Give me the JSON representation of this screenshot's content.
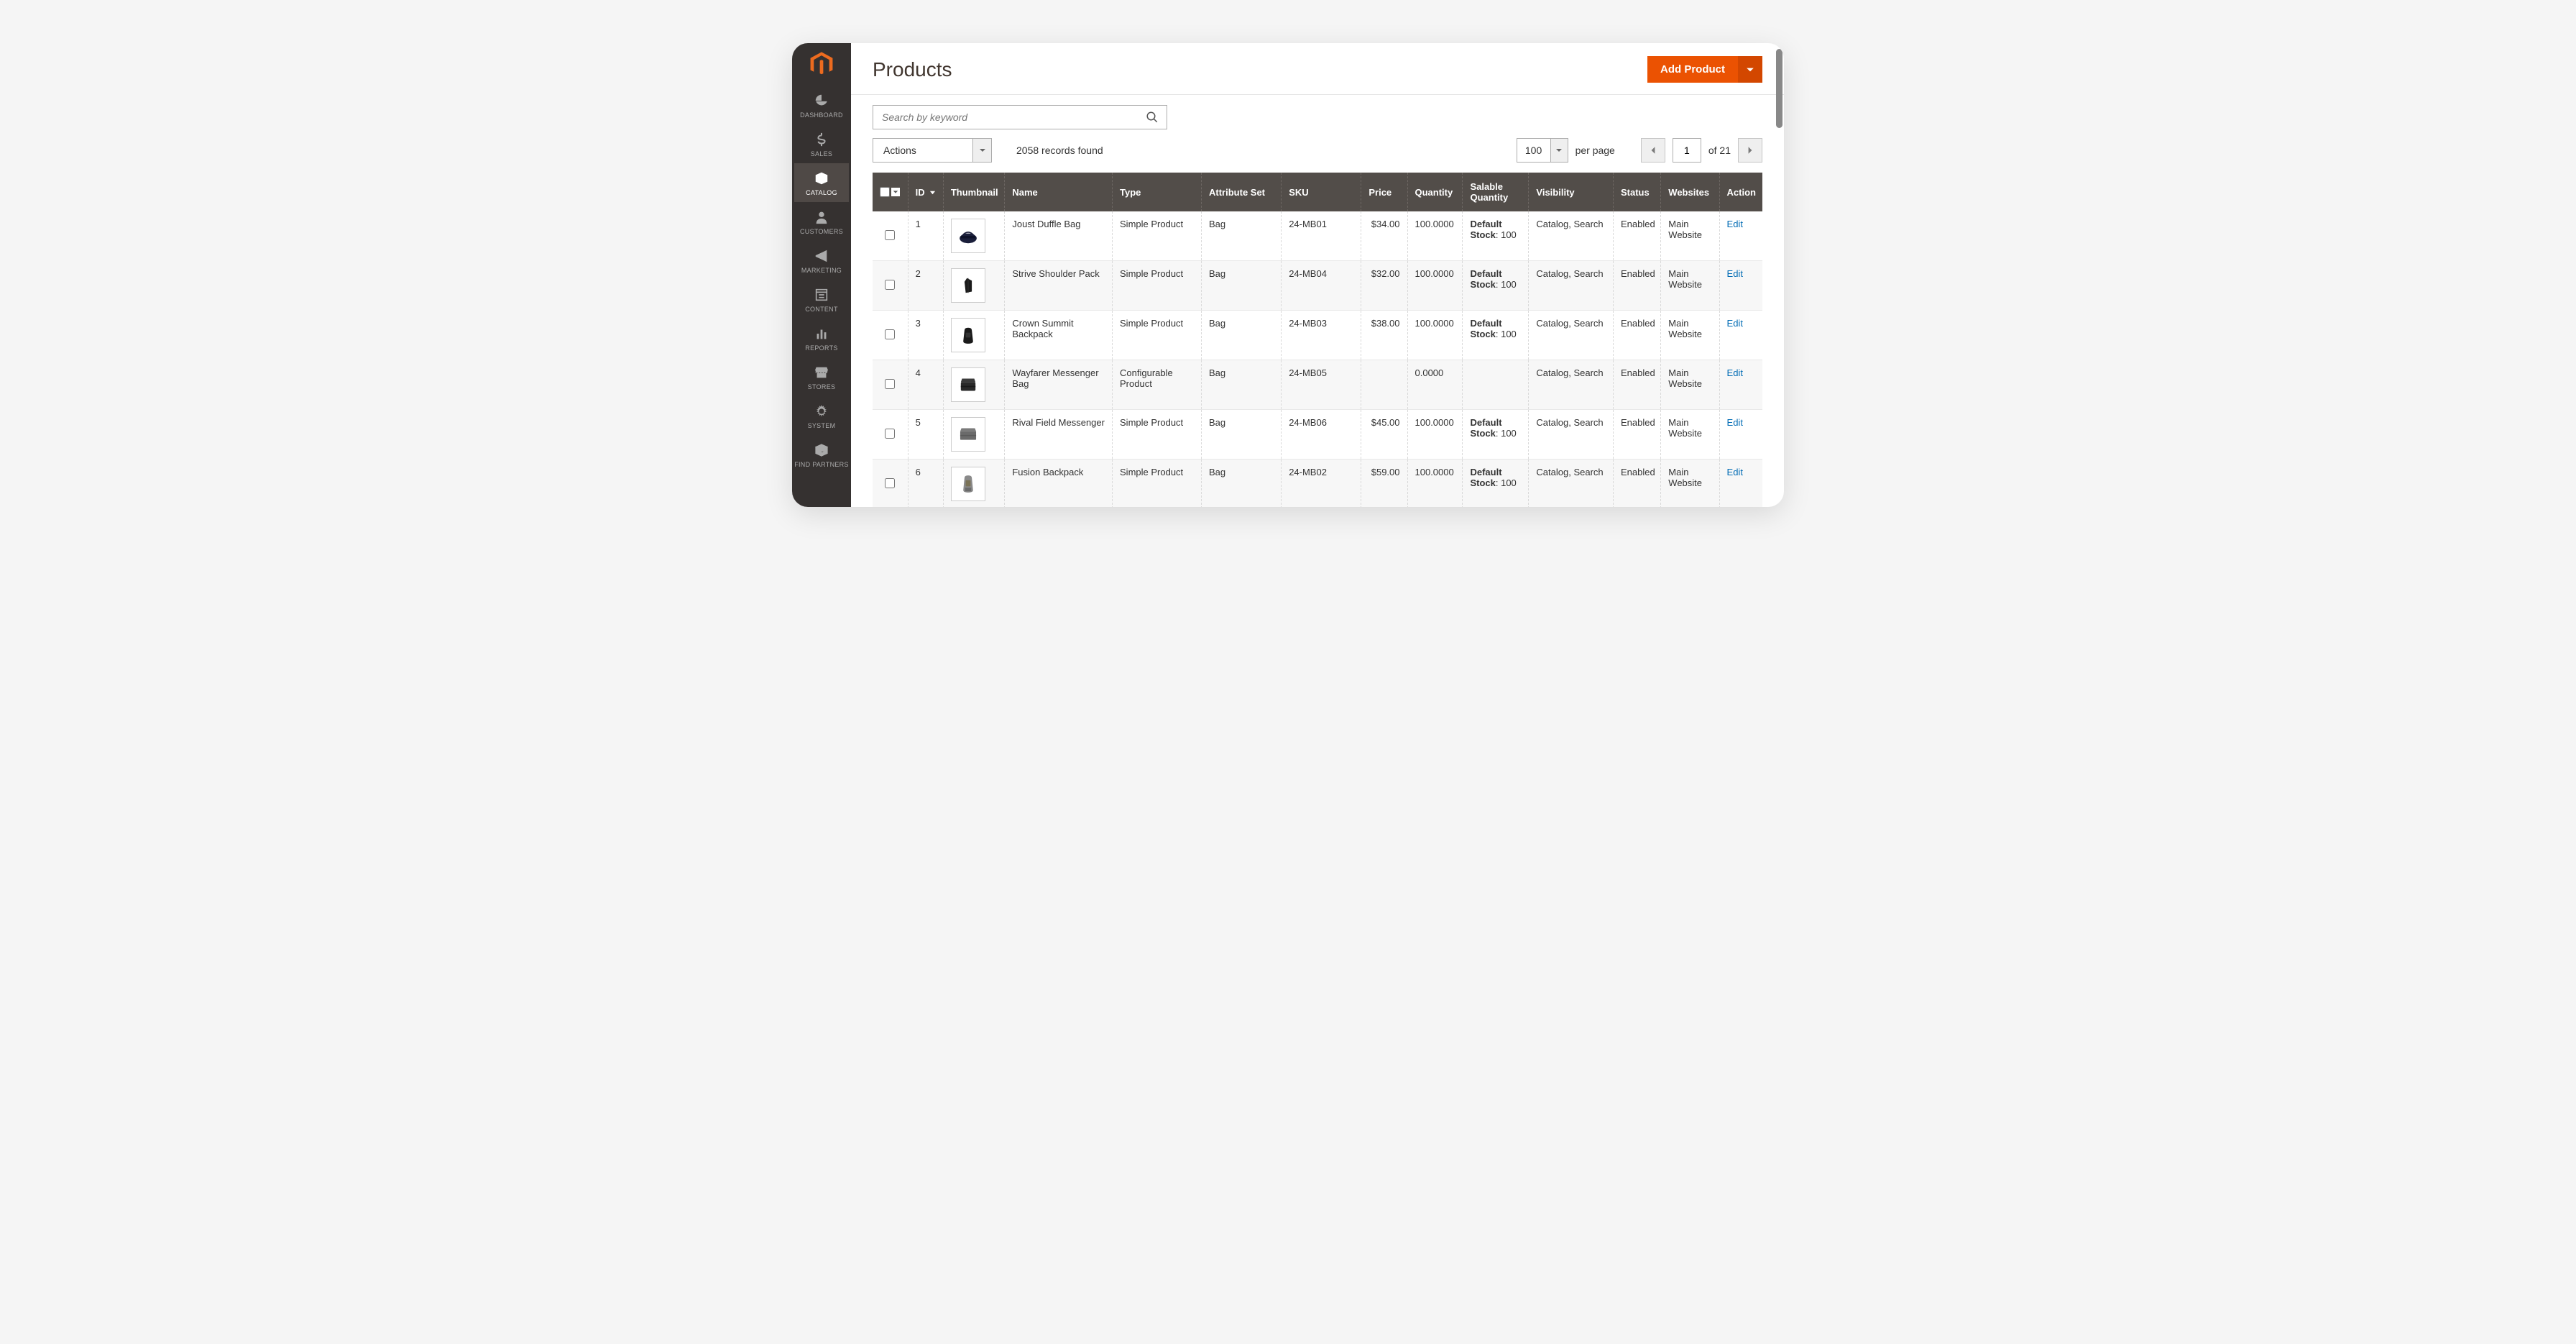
{
  "sidebar": {
    "items": [
      {
        "key": "dashboard",
        "label": "DASHBOARD"
      },
      {
        "key": "sales",
        "label": "SALES"
      },
      {
        "key": "catalog",
        "label": "CATALOG"
      },
      {
        "key": "customers",
        "label": "CUSTOMERS"
      },
      {
        "key": "marketing",
        "label": "MARKETING"
      },
      {
        "key": "content",
        "label": "CONTENT"
      },
      {
        "key": "reports",
        "label": "REPORTS"
      },
      {
        "key": "stores",
        "label": "STORES"
      },
      {
        "key": "system",
        "label": "SYSTEM"
      },
      {
        "key": "partners",
        "label": "FIND PARTNERS"
      }
    ],
    "active": "catalog"
  },
  "header": {
    "title": "Products",
    "add_label": "Add Product"
  },
  "search": {
    "placeholder": "Search by keyword"
  },
  "controls": {
    "actions_label": "Actions",
    "records_found": "2058 records found",
    "per_page_value": "100",
    "per_page_label": "per page",
    "page_current": "1",
    "page_of": "of 21"
  },
  "columns": {
    "id": "ID",
    "thumbnail": "Thumbnail",
    "name": "Name",
    "type": "Type",
    "attribute_set": "Attribute Set",
    "sku": "SKU",
    "price": "Price",
    "quantity": "Quantity",
    "salable": "Salable Quantity",
    "visibility": "Visibility",
    "status": "Status",
    "websites": "Websites",
    "action": "Action"
  },
  "row_action": "Edit",
  "salable_prefix": "Default Stock",
  "rows": [
    {
      "id": "1",
      "name": "Joust Duffle Bag",
      "type": "Simple Product",
      "attr": "Bag",
      "sku": "24-MB01",
      "price": "$34.00",
      "qty": "100.0000",
      "sal": "100",
      "vis": "Catalog, Search",
      "status": "Enabled",
      "web": "Main Website",
      "thumb": "duffle"
    },
    {
      "id": "2",
      "name": "Strive Shoulder Pack",
      "type": "Simple Product",
      "attr": "Bag",
      "sku": "24-MB04",
      "price": "$32.00",
      "qty": "100.0000",
      "sal": "100",
      "vis": "Catalog, Search",
      "status": "Enabled",
      "web": "Main Website",
      "thumb": "shoulder"
    },
    {
      "id": "3",
      "name": "Crown Summit Backpack",
      "type": "Simple Product",
      "attr": "Bag",
      "sku": "24-MB03",
      "price": "$38.00",
      "qty": "100.0000",
      "sal": "100",
      "vis": "Catalog, Search",
      "status": "Enabled",
      "web": "Main Website",
      "thumb": "backpack"
    },
    {
      "id": "4",
      "name": "Wayfarer Messenger Bag",
      "type": "Configurable Product",
      "attr": "Bag",
      "sku": "24-MB05",
      "price": "",
      "qty": "0.0000",
      "sal": "",
      "vis": "Catalog, Search",
      "status": "Enabled",
      "web": "Main Website",
      "thumb": "messenger"
    },
    {
      "id": "5",
      "name": "Rival Field Messenger",
      "type": "Simple Product",
      "attr": "Bag",
      "sku": "24-MB06",
      "price": "$45.00",
      "qty": "100.0000",
      "sal": "100",
      "vis": "Catalog, Search",
      "status": "Enabled",
      "web": "Main Website",
      "thumb": "field"
    },
    {
      "id": "6",
      "name": "Fusion Backpack",
      "type": "Simple Product",
      "attr": "Bag",
      "sku": "24-MB02",
      "price": "$59.00",
      "qty": "100.0000",
      "sal": "100",
      "vis": "Catalog, Search",
      "status": "Enabled",
      "web": "Main Website",
      "thumb": "fusion"
    }
  ],
  "thumbs": {
    "duffle": "<svg viewBox='0 0 40 40'><ellipse cx='20' cy='24' rx='14' ry='8' fill='#1a1e3a'/><path d='M10 20 Q20 8 30 20' stroke='#1a1e3a' stroke-width='2' fill='none'/><rect x='8' y='20' width='24' height='4' fill='#0d1128'/></svg>",
    "shoulder": "<svg viewBox='0 0 40 40'><path d='M18 8 L26 12 L26 30 L16 32 L14 14 Z' fill='#1a1a1a'/><path d='M20 8 L20 32' stroke='#333' stroke-width='1'/></svg>",
    "backpack": "<svg viewBox='0 0 40 40'><path d='M14 12 Q14 8 20 8 Q26 8 26 12 L28 30 Q28 34 20 34 Q12 34 12 30 Z' fill='#1a1a1a'/><rect x='16' y='16' width='8' height='8' fill='#333' rx='1'/></svg>",
    "messenger": "<svg viewBox='0 0 40 40'><rect x='8' y='16' width='24' height='14' fill='#2a2a2a' rx='2'/><path d='M8 16 L32 16 L30 10 L10 10 Z' fill='#3a3a3a'/><rect x='8' y='22' width='24' height='2' fill='#1a1a1a'/></svg>",
    "field": "<svg viewBox='0 0 40 40'><rect x='7' y='15' width='26' height='14' fill='#6b6b6b' rx='1'/><path d='M7 15 L33 15 L31 10 L9 10 Z' fill='#7a7a7a'/><rect x='7' y='21' width='26' height='2' fill='#5a5a5a'/></svg>",
    "fusion": "<svg viewBox='0 0 40 40'><path d='M14 10 Q14 6 20 6 Q26 6 26 10 L28 30 Q28 34 20 34 Q12 34 12 30 Z' fill='#8a8a8a'/><rect x='16' y='14' width='8' height='10' fill='#7a7256' rx='1'/><path d='M15 26 L25 26 L25 32 L15 32 Z' fill='#6a6a6a'/></svg>"
  },
  "nav_icons": {
    "dashboard": "<path d='M12 3 A9 9 0 0 0 3 12 L12 12 Z M3.5 13 A9 9 0 0 0 20.5 13 Z' />",
    "sales": "<path d='M12 2 L12 6 M12 18 L12 22 M12 6 C8 6 7 8 7 9.5 C7 13 17 11 17 14.5 C17 16 16 18 12 18 C9 18 7.5 16.5 7 15' stroke='currentColor' stroke-width='2.2' fill='none'/>",
    "catalog": "<path d='M3 7 L12 3 L21 7 L12 11 Z M3 7 L3 17 L12 21 L12 11 Z M21 7 L21 17 L12 21 L12 11 Z'/>",
    "customers": "<path d='M12 4 A4 4 0 1 1 12 12 A4 4 0 1 1 12 4 M4 22 C4 16 8 14 12 14 C16 14 20 16 20 22 Z'/>",
    "marketing": "<path d='M3 11 L14 6 L14 18 L3 13 Z M14 6 L20 3 L20 21 L14 18 Z'/>",
    "content": "<path d='M4 4 H20 V20 H4 Z M4 8 H20 M8 12 H16 M8 16 H16' stroke='currentColor' stroke-width='1.8' fill='none'/>",
    "reports": "<path d='M5 20 V12 H8 V20 Z M10.5 20 V6 H13.5 V20 Z M16 20 V10 H19 V20 Z'/>",
    "stores": "<path d='M4 4 H20 L22 9 H2 Z M3 9 H21 V11 C21 12 20 13 19 13 C18 13 17 12 17 11 C17 12 16 13 15 13 C14 13 13 12 13 11 C13 12 12 13 11 13 C10 13 9 12 9 11 C9 12 8 13 7 13 C6 13 5 12 5 11 C5 12 4 13 3 13 Z M5 13 V20 H19 V13'/>",
    "system": "<path d='M12 8 A4 4 0 1 1 12 16 A4 4 0 1 1 12 8 M12 2 L13 5 L15.5 3.5 L15 6.5 L18 6 L16.5 8.5 L19.5 9.5 L17 11 L19.5 12.5 L16.5 13.5 L18 16 L15 15.5 L15.5 18.5 L13 17 L12 20 L11 17 L8.5 18.5 L9 15.5 L6 16 L7.5 13.5 L4.5 12.5 L7 11 L4.5 9.5 L7.5 8.5 L6 6 L9 6.5 L8.5 3.5 L11 5 Z' fill-rule='evenodd'/>",
    "partners": "<path d='M3 7 L12 3 L21 7 L12 11 Z M3 7 L3 17 L12 21 L12 11 Z M21 7 L21 17 L12 21 L12 11 Z M8 14 L12 16 L16 14' stroke='currentColor' stroke-width='0.8'/>"
  }
}
